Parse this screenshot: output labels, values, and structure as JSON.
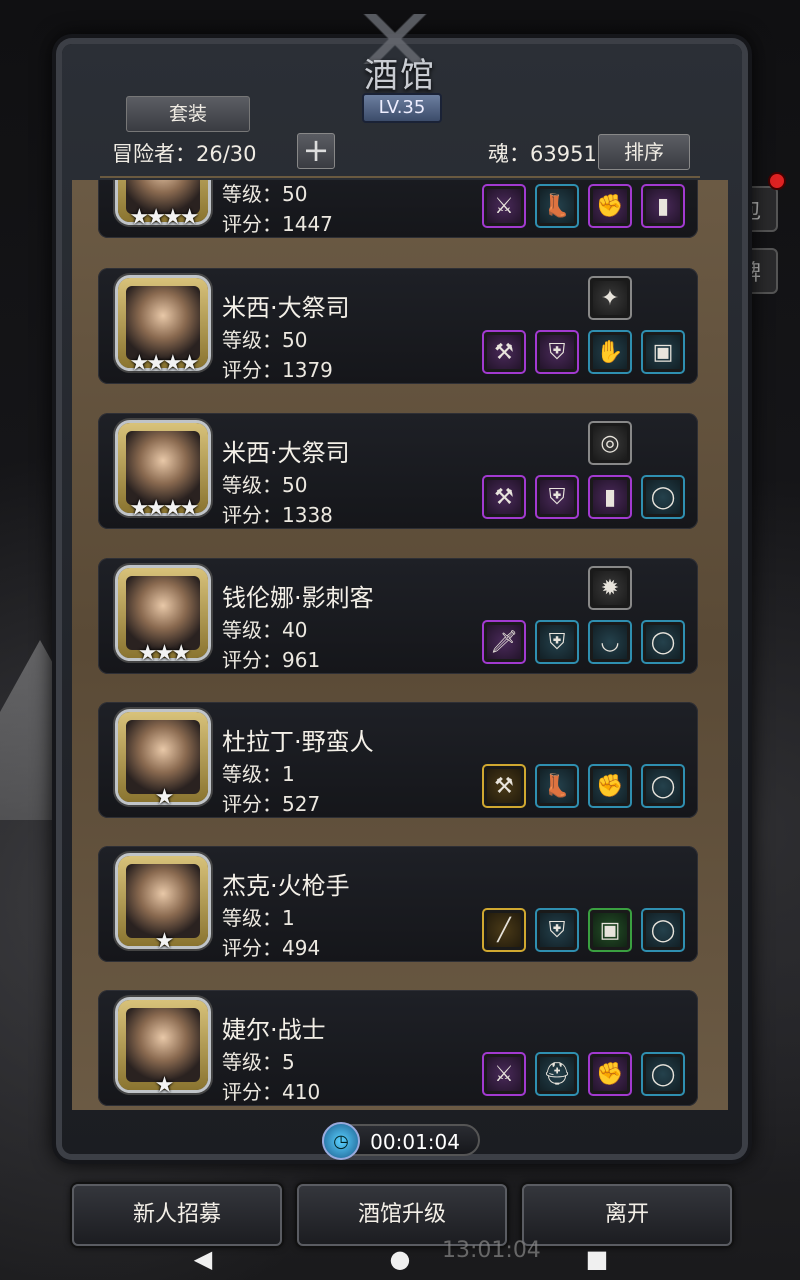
{
  "header": {
    "title": "酒馆",
    "level": "LV.35",
    "set_tab": "套装",
    "adventurers": "冒险者：26/30",
    "plus": "+",
    "soul": "魂：63951",
    "sort": "排序"
  },
  "background": {
    "side_btn_1": "包",
    "side_btn_2": "牌",
    "clock": "13:01:04"
  },
  "heroes": [
    {
      "name": "",
      "level": "等级：50",
      "score": "评分：1447",
      "stars": "★★★★",
      "items": [
        [
          "purple",
          "sword"
        ],
        [
          "blue",
          "boots"
        ],
        [
          "purple",
          "gloves"
        ],
        [
          "purple",
          "leggings"
        ]
      ],
      "extra": null
    },
    {
      "name": "米西·大祭司",
      "level": "等级：50",
      "score": "评分：1379",
      "stars": "★★★★",
      "items": [
        [
          "purple",
          "hammer"
        ],
        [
          "purple",
          "armor"
        ],
        [
          "blue",
          "gauntlet"
        ],
        [
          "blue",
          "chest"
        ]
      ],
      "extra": [
        "gray",
        "claw"
      ]
    },
    {
      "name": "米西·大祭司",
      "level": "等级：50",
      "score": "评分：1338",
      "stars": "★★★★",
      "items": [
        [
          "purple",
          "hammer"
        ],
        [
          "purple",
          "armor"
        ],
        [
          "purple",
          "leggings"
        ],
        [
          "blue",
          "ring"
        ]
      ],
      "extra": [
        "gray",
        "bracelet"
      ]
    },
    {
      "name": "钱伦娜·影刺客",
      "level": "等级：40",
      "score": "评分：961",
      "stars": "★★★",
      "items": [
        [
          "purple",
          "dagger"
        ],
        [
          "blue",
          "armor"
        ],
        [
          "blue",
          "necklace"
        ],
        [
          "blue",
          "ring"
        ]
      ],
      "extra": [
        "gray",
        "flame"
      ]
    },
    {
      "name": "杜拉丁·野蛮人",
      "level": "等级：1",
      "score": "评分：527",
      "stars": "★",
      "items": [
        [
          "gold",
          "axe"
        ],
        [
          "blue",
          "boots"
        ],
        [
          "blue",
          "gloves"
        ],
        [
          "blue",
          "ring"
        ]
      ],
      "extra": null
    },
    {
      "name": "杰克·火枪手",
      "level": "等级：1",
      "score": "评分：494",
      "stars": "★",
      "items": [
        [
          "gold",
          "rifle"
        ],
        [
          "blue",
          "armor"
        ],
        [
          "green",
          "chest"
        ],
        [
          "blue",
          "ring"
        ]
      ],
      "extra": null
    },
    {
      "name": "婕尔·战士",
      "level": "等级：5",
      "score": "评分：410",
      "stars": "★",
      "items": [
        [
          "purple",
          "sword"
        ],
        [
          "blue",
          "helmet"
        ],
        [
          "purple",
          "gloves"
        ],
        [
          "blue",
          "ring"
        ]
      ],
      "extra": null
    }
  ],
  "timer": "00:01:04",
  "buttons": {
    "recruit": "新人招募",
    "upgrade": "酒馆升级",
    "leave": "离开"
  },
  "nav": {
    "back": "◀",
    "home": "●",
    "recent": "■"
  }
}
